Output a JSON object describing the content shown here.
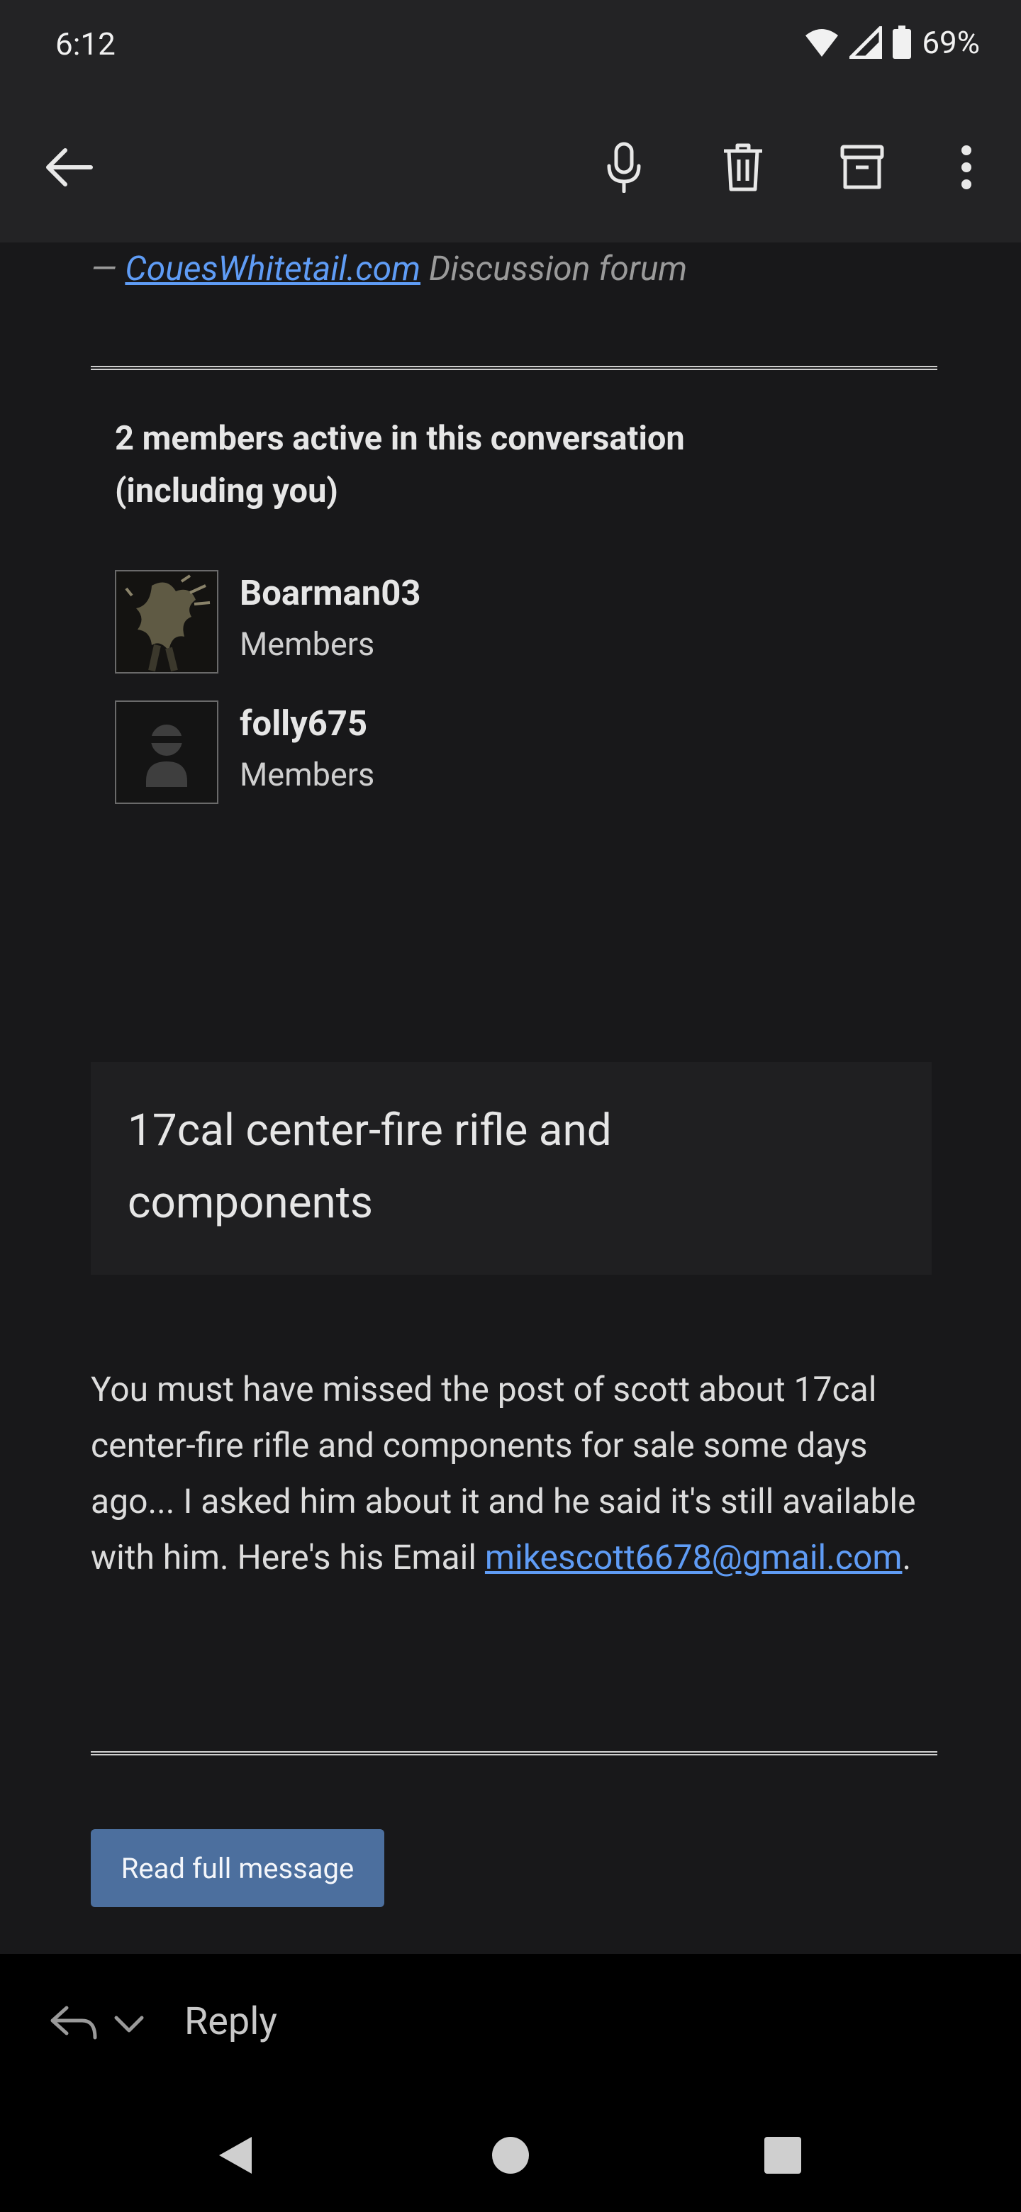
{
  "status": {
    "time": "6:12",
    "battery": "69%"
  },
  "toolbar": {
    "back_icon": "arrow-left-icon",
    "actions": [
      "mic-icon",
      "trash-icon",
      "archive-icon",
      "more-vert-icon"
    ]
  },
  "email": {
    "forum_prefix": "—",
    "forum_link": "CouesWhitetail.com",
    "forum_suffix": "Discussion forum",
    "members_title": "2 members active in this conversation (including you)",
    "members": [
      {
        "name": "Boarman03",
        "role": "Members"
      },
      {
        "name": "folly675",
        "role": "Members"
      }
    ],
    "card_title": "17cal center-fire rifle and components",
    "body": "You must have missed the post of scott about 17cal center-fire rifle and components for sale some days ago... I asked him about it and he said it's still available with him. Here's his Email ",
    "email_link": "mikescott6678@gmail.com",
    "email_suffix": ".",
    "read_button": "Read full message"
  },
  "reply": {
    "label": "Reply"
  },
  "colors": {
    "link": "#5f9cf5",
    "button": "#4c6f9e",
    "background": "#18181a"
  }
}
